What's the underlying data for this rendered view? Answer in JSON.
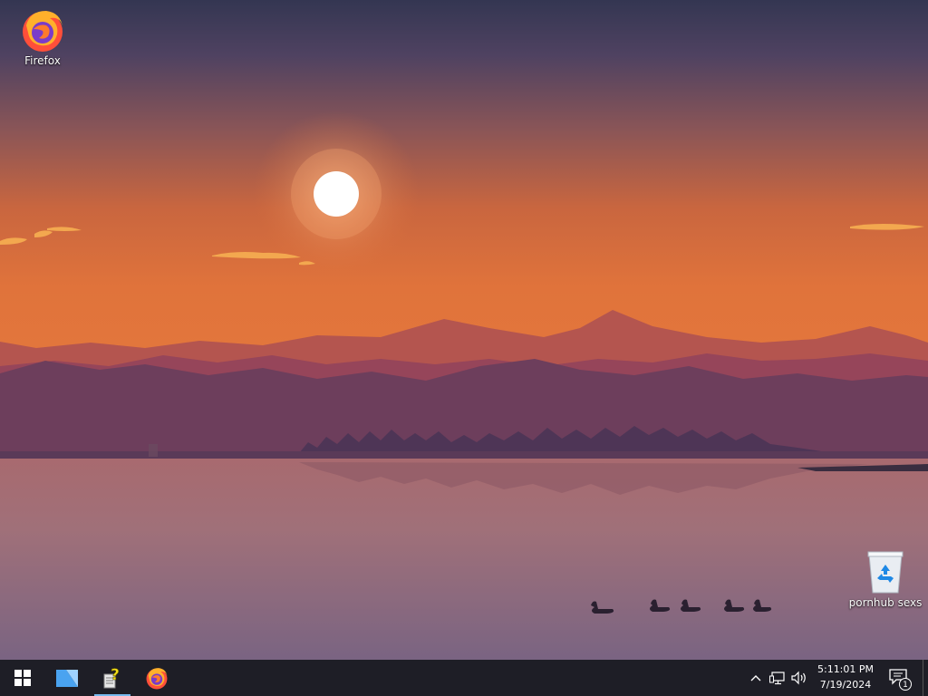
{
  "desktop": {
    "icons": [
      {
        "label": "Firefox",
        "icon": "firefox-icon"
      },
      {
        "label": "pornhub sexs",
        "icon": "recycle-bin-icon"
      }
    ]
  },
  "taskbar": {
    "start": {
      "icon": "windows-start-icon"
    },
    "apps": [
      {
        "icon": "file-explorer-icon",
        "active": false
      },
      {
        "icon": "help-document-icon",
        "active": true
      },
      {
        "icon": "firefox-icon",
        "active": false
      }
    ],
    "tray": {
      "icons": [
        "chevron-up-icon",
        "network-icon",
        "volume-icon"
      ],
      "time": "5:11:01 PM",
      "date": "7/19/2024",
      "notification_count": "1"
    }
  },
  "colors": {
    "taskbar_bg": "#1e1e26",
    "accent": "#76b9ed"
  }
}
